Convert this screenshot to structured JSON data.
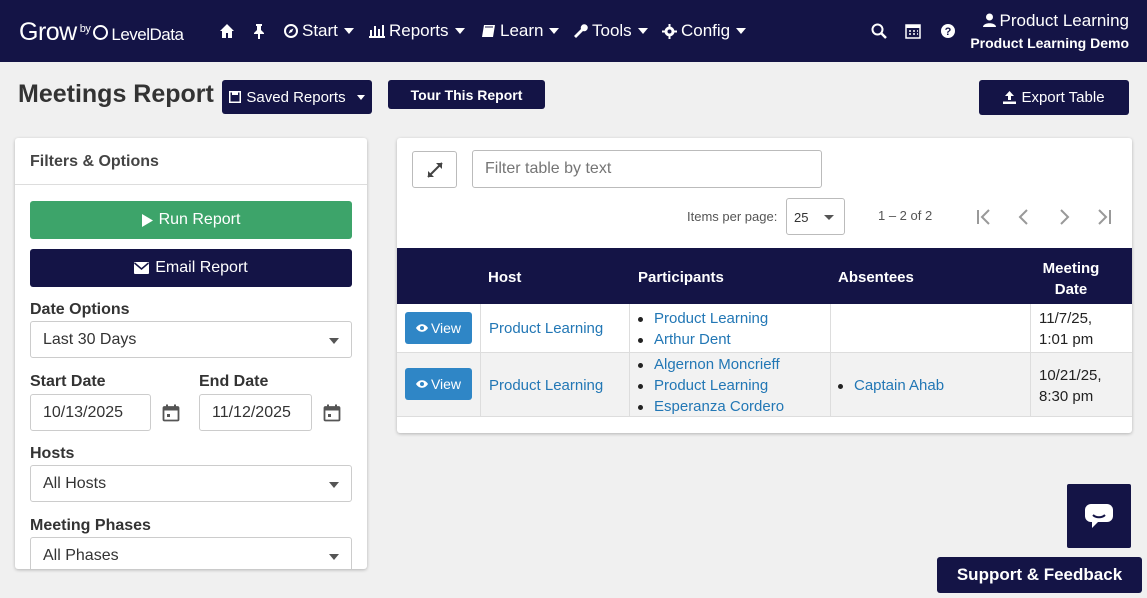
{
  "brand": {
    "grow": "Grow",
    "by": "by",
    "level_data": "LevelData"
  },
  "nav": {
    "start": "Start",
    "reports": "Reports",
    "learn": "Learn",
    "tools": "Tools",
    "config": "Config"
  },
  "user": {
    "name": "Product Learning",
    "org": "Product Learning Demo"
  },
  "page": {
    "title": "Meetings Report",
    "saved_reports": "Saved Reports",
    "tour": "Tour This Report",
    "export": "Export Table"
  },
  "filters": {
    "heading": "Filters & Options",
    "run": "Run Report",
    "email": "Email Report",
    "date_options_label": "Date Options",
    "date_options_value": "Last 30 Days",
    "start_date_label": "Start Date",
    "start_date_value": "10/13/2025",
    "end_date_label": "End Date",
    "end_date_value": "11/12/2025",
    "hosts_label": "Hosts",
    "hosts_value": "All Hosts",
    "phases_label": "Meeting Phases",
    "phases_value": "All Phases"
  },
  "table": {
    "filter_placeholder": "Filter table by text",
    "items_per_page_label": "Items per page:",
    "items_per_page": "25",
    "range": "1 – 2 of 2",
    "columns": {
      "host": "Host",
      "participants": "Participants",
      "absentees": "Absentees",
      "meeting_date_1": "Meeting",
      "meeting_date_2": "Date"
    },
    "view_label": "View",
    "rows": [
      {
        "host": "Product Learning",
        "participants": [
          "Product Learning",
          "Arthur Dent"
        ],
        "absentees": [],
        "date_1": "11/7/25,",
        "date_2": "1:01 pm"
      },
      {
        "host": "Product Learning",
        "participants": [
          "Algernon Moncrieff",
          "Product Learning",
          "Esperanza Cordero"
        ],
        "absentees": [
          "Captain Ahab"
        ],
        "date_1": "10/21/25,",
        "date_2": "8:30 pm"
      }
    ]
  },
  "support": "Support & Feedback",
  "colors": {
    "navy": "#141446",
    "green": "#3da46a",
    "blue": "#2f86c6",
    "link": "#2277b5"
  }
}
